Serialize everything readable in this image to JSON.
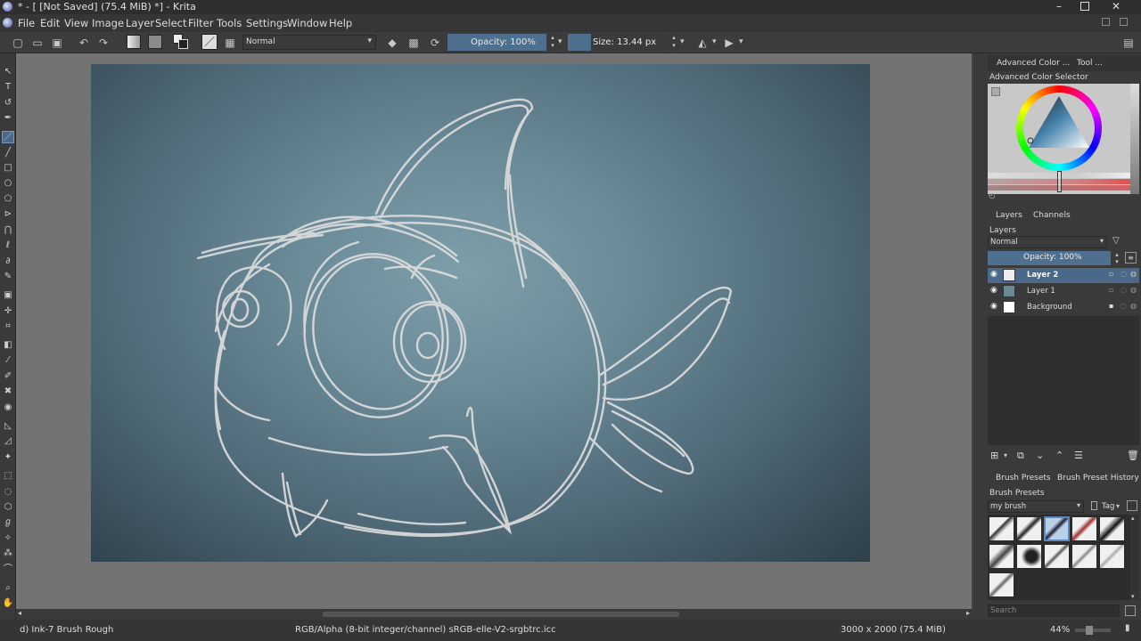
{
  "window": {
    "title": "* - [ [Not Saved]  (75.4 MiB) *] - Krita",
    "controls": [
      "minimize-icon",
      "restore-icon",
      "close-icon"
    ]
  },
  "menu": [
    "File",
    "Edit",
    "View",
    "Image",
    "Layer",
    "Select",
    "Filter",
    "Tools",
    "Settings",
    "Window",
    "Help"
  ],
  "toolbar": {
    "blend_mode": "Normal",
    "opacity_label": "Opacity: 100%",
    "opacity_value": 1.0,
    "size_label": "Size: 13.44 px",
    "size_value": 13.44
  },
  "dock": {
    "tabs": [
      "Advanced Color ...",
      "Tool ..."
    ],
    "color_selector_title": "Advanced Color Selector",
    "layers_tabs": [
      "Layers",
      "Channels"
    ],
    "layers_title": "Layers",
    "layers_blend": "Normal",
    "layers_opacity": "Opacity:  100%",
    "layers": [
      {
        "name": "Layer 2",
        "selected": true
      },
      {
        "name": "Layer 1",
        "selected": false
      },
      {
        "name": "Background",
        "selected": false
      }
    ],
    "brush_tabs": [
      "Brush Presets",
      "Brush Preset History"
    ],
    "brush_title": "Brush Presets",
    "brush_filter": "my brush",
    "brush_tag": "Tag",
    "search_placeholder": "Search"
  },
  "status": {
    "brush": "d) Ink-7 Brush Rough",
    "color_model": "RGB/Alpha (8-bit integer/channel)  sRGB-elle-V2-srgbtrc.icc",
    "dimensions": "3000 x 2000 (75.4 MiB)",
    "zoom": "44%"
  },
  "colors": {
    "accent": "#4f6f8f",
    "selection": "#4a6888",
    "canvas_bg": "#737373",
    "sketch_stroke": "#d8d8d8"
  }
}
